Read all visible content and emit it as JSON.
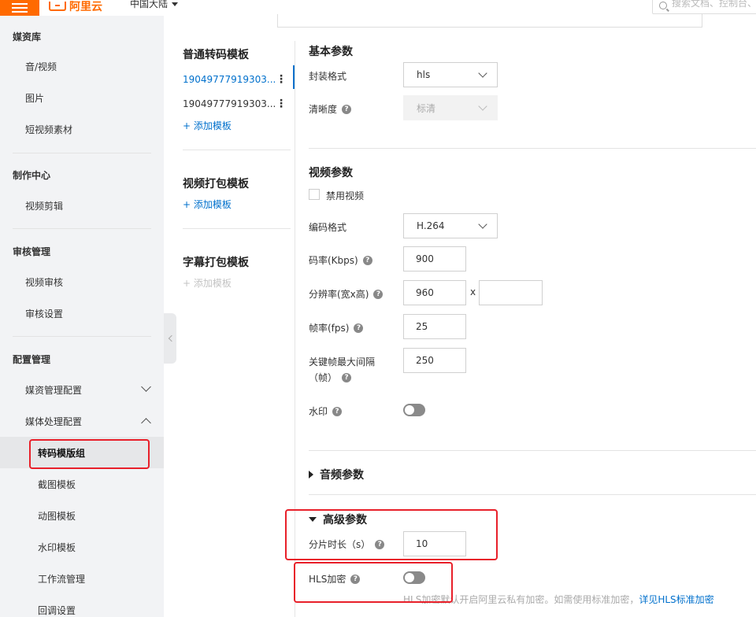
{
  "header": {
    "logo_text": "阿里云",
    "region": "中国大陆",
    "search_placeholder": "搜索文档、控制台、"
  },
  "sidebar": {
    "groups": [
      {
        "title": "媒资库",
        "items": [
          "音/视频",
          "图片",
          "短视频素材"
        ]
      },
      {
        "title": "制作中心",
        "items": [
          "视频剪辑"
        ]
      },
      {
        "title": "审核管理",
        "items": [
          "视频审核",
          "审核设置"
        ]
      },
      {
        "title": "配置管理",
        "items": [
          "媒资管理配置",
          "媒体处理配置"
        ]
      }
    ],
    "sub_items": [
      "转码模版组",
      "截图模板",
      "动图模板",
      "水印模板",
      "工作流管理",
      "回调设置"
    ]
  },
  "templates": {
    "transcode": {
      "title": "普通转码模板",
      "items": [
        "19049777919303...",
        "19049777919303..."
      ],
      "add_label": "+ 添加模板"
    },
    "package": {
      "title": "视频打包模板",
      "add_label": "+ 添加模板"
    },
    "subtitle": {
      "title": "字幕打包模板",
      "add_label": "+ 添加模板"
    },
    "kebab": "⋮"
  },
  "form": {
    "basic": {
      "title": "基本参数",
      "container_label": "封装格式",
      "container_value": "hls",
      "quality_label": "清晰度",
      "quality_value": "标清"
    },
    "video": {
      "title": "视频参数",
      "disable_video_label": "禁用视频",
      "codec_label": "编码格式",
      "codec_value": "H.264",
      "bitrate_label": "码率(Kbps)",
      "bitrate_value": "900",
      "resolution_label": "分辨率(宽x高)",
      "width_value": "960",
      "height_value": "",
      "x_sep": "x",
      "fps_label": "帧率(fps)",
      "fps_value": "25",
      "gop_label_line1": "关键帧最大间隔",
      "gop_label_line2": "（帧）",
      "gop_value": "250",
      "watermark_label": "水印",
      "watermark_on": false
    },
    "audio": {
      "title": "音频参数"
    },
    "advanced": {
      "title": "高级参数",
      "segment_label": "分片时长（s）",
      "segment_value": "10",
      "hls_encrypt_label": "HLS加密",
      "hls_encrypt_on": false,
      "hint_text": "HLS加密默认开启阿里云私有加密。如需使用标准加密，",
      "hint_link": "详见HLS标准加密"
    },
    "help_glyph": "?"
  },
  "colors": {
    "brand": "#ff6a00",
    "link": "#0070cc",
    "highlight": "#e8202a"
  }
}
